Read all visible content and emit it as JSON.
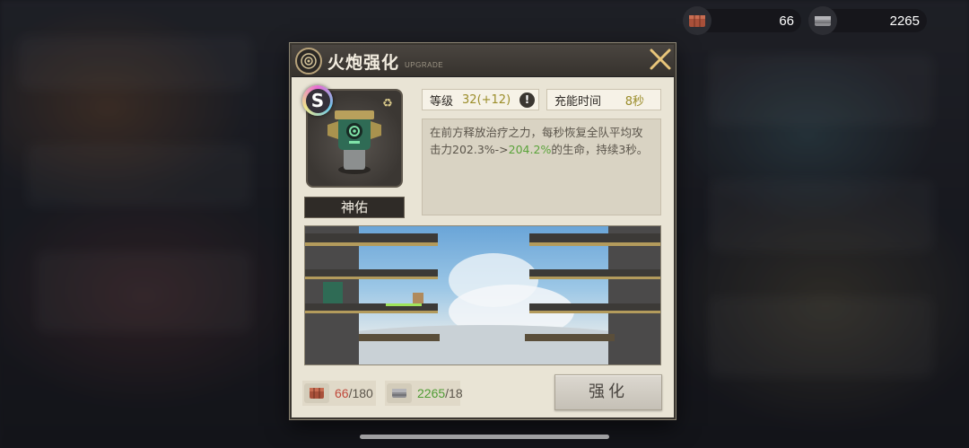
{
  "currency": {
    "wood": {
      "icon": "wood-crate-icon",
      "amount": "66"
    },
    "iron": {
      "icon": "iron-ingot-icon",
      "amount": "2265"
    }
  },
  "dialog": {
    "title": "火炮强化",
    "subtitle": "UPGRADE",
    "close_icon": "close-icon"
  },
  "cannon": {
    "rank": "S",
    "name": "神佑"
  },
  "stats": {
    "level_label": "等级",
    "level_value": "32",
    "level_extra": "(+12)",
    "charge_label": "充能时间",
    "charge_value": "8秒"
  },
  "description": {
    "part1": "在前方释放治疗之力，每秒恢复全队平均攻击力202.3%->",
    "highlight": "204.2%",
    "part2": "的生命，持续3秒。"
  },
  "costs": {
    "wood_have": "66",
    "wood_need": "/180",
    "iron_have": "2265",
    "iron_need": "/18"
  },
  "upgrade_button": "强化",
  "colors": {
    "accent_green": "#4f9c34",
    "warning_red": "#c0493b",
    "level_gold": "#9b8d2a",
    "panel_bg": "#e9e4d5",
    "header_bg": "#3f3b36"
  }
}
